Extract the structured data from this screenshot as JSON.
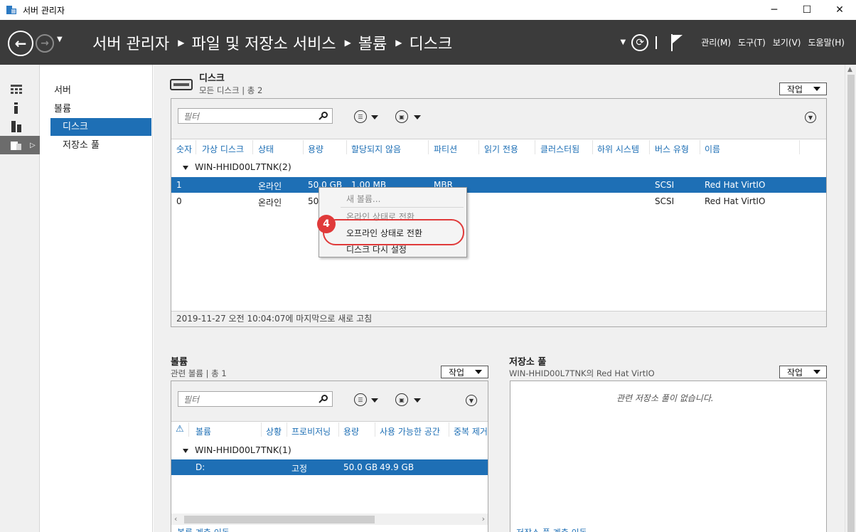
{
  "window": {
    "title": "서버 관리자",
    "controls": [
      "─",
      "☐",
      "✕"
    ]
  },
  "header": {
    "breadcrumb": [
      "서버 관리자",
      "파일 및 저장소 서비스",
      "볼륨",
      "디스크"
    ],
    "menu": [
      "관리(M)",
      "도구(T)",
      "보기(V)",
      "도움말(H)"
    ]
  },
  "subnav": {
    "items": [
      "서버",
      "볼륨",
      "디스크",
      "저장소 풀"
    ],
    "selected": "디스크"
  },
  "disks": {
    "title": "디스크",
    "subtitle": "모든 디스크 | 총 2",
    "task_label": "작업",
    "filter_placeholder": "필터",
    "columns": [
      "숫자",
      "가상 디스크",
      "상태",
      "용량",
      "할당되지 않음",
      "파티션",
      "읽기 전용",
      "클러스터됨",
      "하위 시스템",
      "버스 유형",
      "이름"
    ],
    "group_label": "WIN-HHID00L7TNK(2)",
    "rows": [
      {
        "number": "1",
        "status": "온라인",
        "capacity": "50.0 GB",
        "unallocated": "1.00 MB",
        "partition": "MBR",
        "bus": "SCSI",
        "name": "Red Hat VirtIO"
      },
      {
        "number": "0",
        "status": "온라인",
        "capacity": "50.",
        "unallocated": "",
        "partition": "",
        "bus": "SCSI",
        "name": "Red Hat VirtIO"
      }
    ],
    "status": "2019-11-27 오전 10:04:07에 마지막으로 새로 고침"
  },
  "context_menu": {
    "items": [
      "새 볼륨...",
      "온라인 상태로 전환",
      "오프라인 상태로 전환",
      "디스크 다시 설정"
    ],
    "step_badge": "4"
  },
  "volumes": {
    "title": "볼륨",
    "subtitle": "관련 볼륨 | 총 1",
    "task_label": "작업",
    "filter_placeholder": "필터",
    "columns": [
      "볼륨",
      "상황",
      "프로비저닝",
      "용량",
      "사용 가능한 공간",
      "중복 제거"
    ],
    "group_label": "WIN-HHID00L7TNK(1)",
    "rows": [
      {
        "volume": "D:",
        "provisioning": "고정",
        "capacity": "50.0 GB",
        "free": "49.9 GB"
      }
    ],
    "bottom_link": "볼륨 계층 이동"
  },
  "pools": {
    "title": "저장소 풀",
    "subtitle": "WIN-HHID00L7TNK의 Red Hat VirtIO",
    "task_label": "작업",
    "empty": "관련 저장소 풀이 없습니다.",
    "bottom_link": "저장소 풀 계층 이동"
  },
  "colors": {
    "accent": "#1e6fb5",
    "header": "#3b3b3b",
    "highlight": "#e03a3a"
  }
}
